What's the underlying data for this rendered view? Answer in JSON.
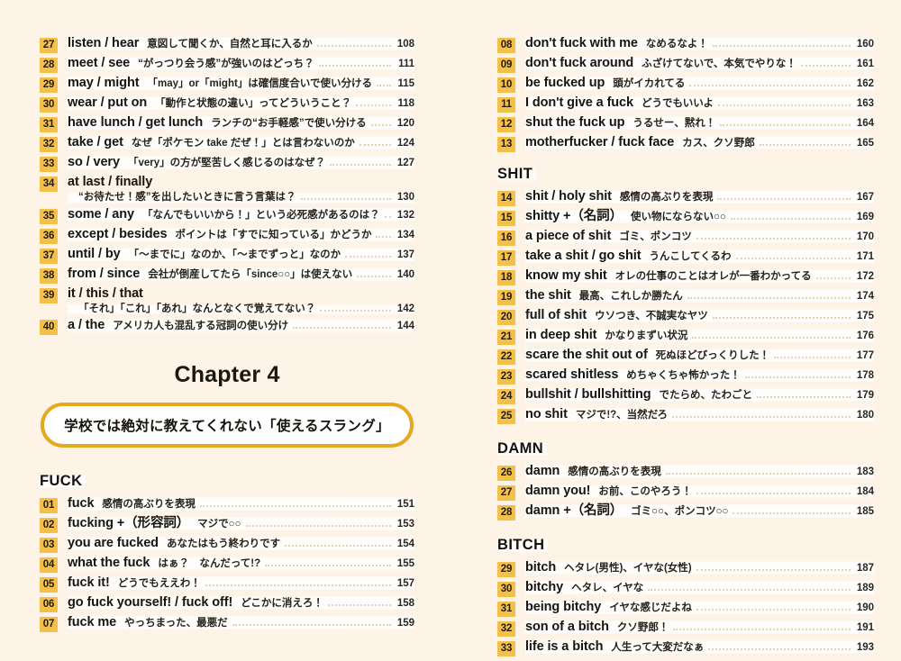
{
  "left_column": {
    "top_entries": [
      {
        "num": "27",
        "term": "listen / hear",
        "gloss": "意図して聞くか、自然と耳に入るか",
        "page": "108",
        "wrap": false
      },
      {
        "num": "28",
        "term": "meet / see",
        "gloss": "“がっつり会う感”が強いのはどっち？",
        "page": "111",
        "wrap": false
      },
      {
        "num": "29",
        "term": "may / might",
        "gloss": "「may」or「might」は確信度合いで使い分ける",
        "page": "115",
        "wrap": false
      },
      {
        "num": "30",
        "term": "wear / put on",
        "gloss": "「動作と状態の違い」ってどういうこと？",
        "page": "118",
        "wrap": false
      },
      {
        "num": "31",
        "term": "have lunch / get lunch",
        "gloss": "ランチの“お手軽感”で使い分ける",
        "page": "120",
        "wrap": false
      },
      {
        "num": "32",
        "term": "take / get",
        "gloss": "なぜ「ポケモン take だぜ！」とは言わないのか",
        "page": "124",
        "wrap": false
      },
      {
        "num": "33",
        "term": "so / very",
        "gloss": "「very」の方が堅苦しく感じるのはなぜ？",
        "page": "127",
        "wrap": false
      },
      {
        "num": "34",
        "term": "at last / finally",
        "gloss": "“お待たせ！感”を出したいときに言う言葉は？",
        "page": "130",
        "wrap": true
      },
      {
        "num": "35",
        "term": "some / any",
        "gloss": "「なんでもいいから！」という必死感があるのは？",
        "page": "132",
        "wrap": false
      },
      {
        "num": "36",
        "term": "except / besides",
        "gloss": "ポイントは「すでに知っている」かどうか",
        "page": "134",
        "wrap": false
      },
      {
        "num": "37",
        "term": "until / by",
        "gloss": "「〜までに」なのか、「〜までずっと」なのか",
        "page": "137",
        "wrap": false
      },
      {
        "num": "38",
        "term": "from / since",
        "gloss": "会社が倒産してたら「since○○」は使えない",
        "page": "140",
        "wrap": false
      },
      {
        "num": "39",
        "term": "it / this / that",
        "gloss": "「それ」「これ」「あれ」なんとなくで覚えてない？",
        "page": "142",
        "wrap": true
      },
      {
        "num": "40",
        "term": "a / the",
        "gloss": "アメリカ人も混乱する冠詞の使い分け",
        "page": "144",
        "wrap": false
      }
    ],
    "chapter": {
      "title": "Chapter 4",
      "subtitle": "学校では絶対に教えてくれない「使えるスラング」"
    },
    "sections": [
      {
        "heading": "FUCK",
        "entries": [
          {
            "num": "01",
            "term": "fuck",
            "gloss": "感情の高ぶりを表現",
            "page": "151",
            "wrap": false
          },
          {
            "num": "02",
            "term": "fucking +（形容詞）",
            "gloss": "マジで○○",
            "page": "153",
            "wrap": false
          },
          {
            "num": "03",
            "term": "you are fucked",
            "gloss": "あなたはもう終わりです",
            "page": "154",
            "wrap": false
          },
          {
            "num": "04",
            "term": "what the fuck",
            "gloss": "はぁ？　なんだって!?",
            "page": "155",
            "wrap": false
          },
          {
            "num": "05",
            "term": "fuck it!",
            "gloss": "どうでもええわ！",
            "page": "157",
            "wrap": false
          },
          {
            "num": "06",
            "term": "go fuck yourself! / fuck off!",
            "gloss": "どこかに消えろ！",
            "page": "158",
            "wrap": false
          },
          {
            "num": "07",
            "term": "fuck me",
            "gloss": "やっちまった、最悪だ",
            "page": "159",
            "wrap": false
          }
        ]
      }
    ]
  },
  "right_column": {
    "top_entries": [
      {
        "num": "08",
        "term": "don't fuck with me",
        "gloss": "なめるなよ！",
        "page": "160",
        "wrap": false
      },
      {
        "num": "09",
        "term": "don't fuck around",
        "gloss": "ふざけてないで、本気でやりな！",
        "page": "161",
        "wrap": false
      },
      {
        "num": "10",
        "term": "be fucked up",
        "gloss": "頭がイカれてる",
        "page": "162",
        "wrap": false
      },
      {
        "num": "11",
        "term": "I don't give a fuck",
        "gloss": "どうでもいいよ",
        "page": "163",
        "wrap": false
      },
      {
        "num": "12",
        "term": "shut the fuck up",
        "gloss": "うるせー、黙れ！",
        "page": "164",
        "wrap": false
      },
      {
        "num": "13",
        "term": "motherfucker / fuck face",
        "gloss": "カス、クソ野郎",
        "page": "165",
        "wrap": false
      }
    ],
    "sections": [
      {
        "heading": "SHIT",
        "entries": [
          {
            "num": "14",
            "term": "shit / holy shit",
            "gloss": "感情の高ぶりを表現",
            "page": "167",
            "wrap": false
          },
          {
            "num": "15",
            "term": "shitty +（名詞）",
            "gloss": "使い物にならない○○",
            "page": "169",
            "wrap": false
          },
          {
            "num": "16",
            "term": "a piece of shit",
            "gloss": "ゴミ、ポンコツ",
            "page": "170",
            "wrap": false
          },
          {
            "num": "17",
            "term": "take a shit / go shit",
            "gloss": "うんこしてくるわ",
            "page": "171",
            "wrap": false
          },
          {
            "num": "18",
            "term": "know my shit",
            "gloss": "オレの仕事のことはオレが一番わかってる",
            "page": "172",
            "wrap": false
          },
          {
            "num": "19",
            "term": "the shit",
            "gloss": "最高、これしか勝たん",
            "page": "174",
            "wrap": false
          },
          {
            "num": "20",
            "term": "full of shit",
            "gloss": "ウソつき、不誠実なヤツ",
            "page": "175",
            "wrap": false
          },
          {
            "num": "21",
            "term": "in deep shit",
            "gloss": "かなりまずい状況",
            "page": "176",
            "wrap": false
          },
          {
            "num": "22",
            "term": "scare the shit out of",
            "gloss": "死ぬほどびっくりした！",
            "page": "177",
            "wrap": false
          },
          {
            "num": "23",
            "term": "scared shitless",
            "gloss": "めちゃくちゃ怖かった！",
            "page": "178",
            "wrap": false
          },
          {
            "num": "24",
            "term": "bullshit / bullshitting",
            "gloss": "でたらめ、たわごと",
            "page": "179",
            "wrap": false
          },
          {
            "num": "25",
            "term": "no shit",
            "gloss": "マジで!?、当然だろ",
            "page": "180",
            "wrap": false
          }
        ]
      },
      {
        "heading": "DAMN",
        "entries": [
          {
            "num": "26",
            "term": "damn",
            "gloss": "感情の高ぶりを表現",
            "page": "183",
            "wrap": false
          },
          {
            "num": "27",
            "term": "damn you!",
            "gloss": "お前、このやろう！",
            "page": "184",
            "wrap": false
          },
          {
            "num": "28",
            "term": "damn +（名詞）",
            "gloss": "ゴミ○○、ポンコツ○○",
            "page": "185",
            "wrap": false
          }
        ]
      },
      {
        "heading": "BITCH",
        "entries": [
          {
            "num": "29",
            "term": "bitch",
            "gloss": "ヘタレ(男性)、イヤな(女性)",
            "page": "187",
            "wrap": false
          },
          {
            "num": "30",
            "term": "bitchy",
            "gloss": "ヘタレ、イヤな",
            "page": "189",
            "wrap": false
          },
          {
            "num": "31",
            "term": "being bitchy",
            "gloss": "イヤな感じだよね",
            "page": "190",
            "wrap": false
          },
          {
            "num": "32",
            "term": "son of a bitch",
            "gloss": "クソ野郎！",
            "page": "191",
            "wrap": false
          },
          {
            "num": "33",
            "term": "life is a bitch",
            "gloss": "人生って大変だなぁ",
            "page": "193",
            "wrap": false
          }
        ]
      }
    ]
  },
  "colors": {
    "page_background": "#fdf3e7",
    "number_badge": "#f3c04a",
    "chapter_box_border": "#e6a81c",
    "chapter_box_fill": "#ffffff",
    "leader_dots": "#e4d2b4",
    "text": "#17150f"
  }
}
